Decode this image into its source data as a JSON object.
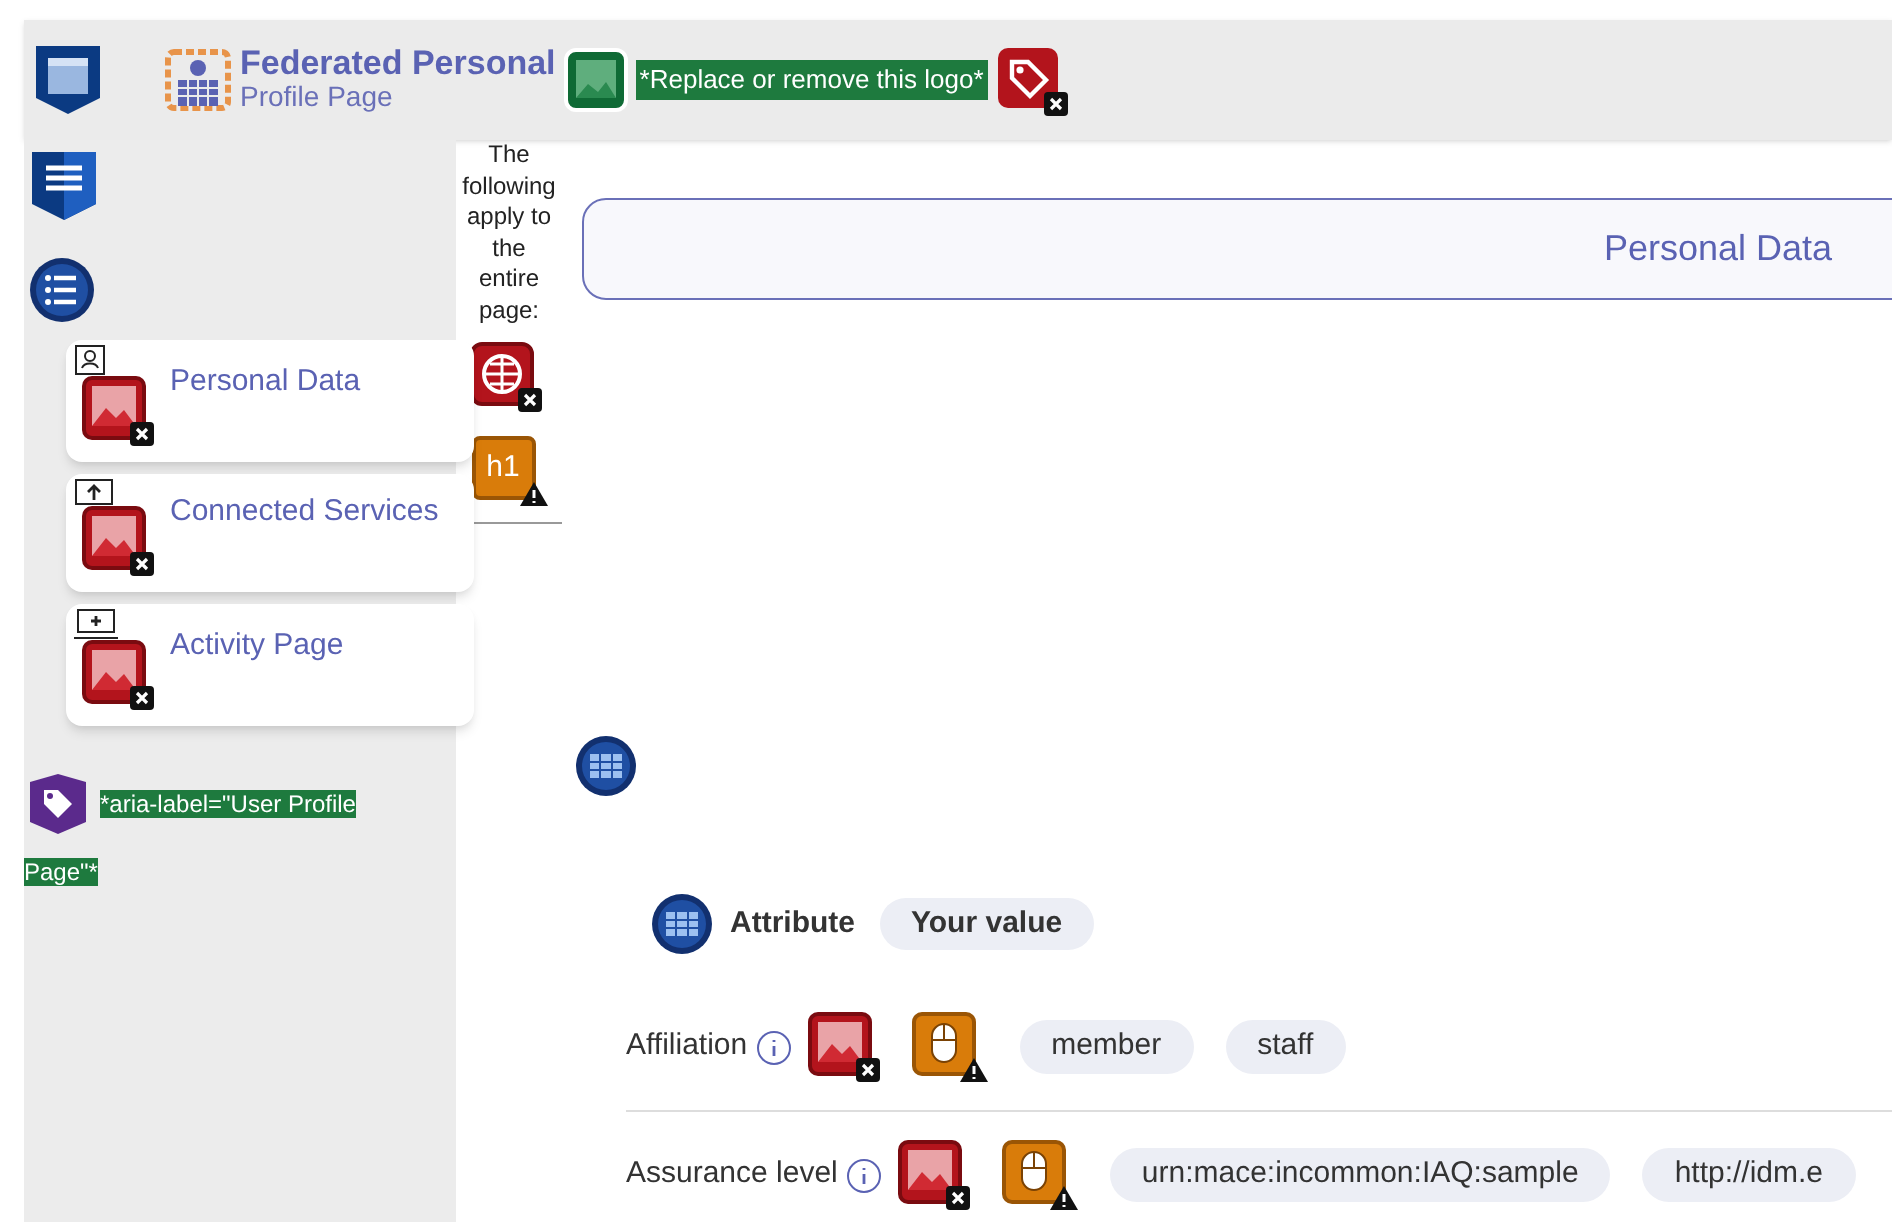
{
  "header": {
    "logo_title": "Federated Personal",
    "logo_subtitle": "Profile Page",
    "alt_text": "*Replace or remove this logo*"
  },
  "nav": {
    "items": [
      {
        "label": "Personal Data",
        "kind": "person"
      },
      {
        "label": "Connected Services",
        "kind": "upload"
      },
      {
        "label": "Activity Page",
        "kind": "laptop"
      }
    ],
    "aria_label": "*aria-label=\"User Profile Page\"*"
  },
  "page_note": "The following apply to the entire page:",
  "heading_badge": "h1",
  "section_title": "Personal Data",
  "table": {
    "columns": [
      "Attribute",
      "Your value"
    ],
    "rows": [
      {
        "name": "Affiliation",
        "values": [
          "member",
          "staff"
        ]
      },
      {
        "name": "Assurance level",
        "values": [
          "urn:mace:incommon:IAQ:sample",
          "http://idm.e"
        ]
      }
    ]
  }
}
